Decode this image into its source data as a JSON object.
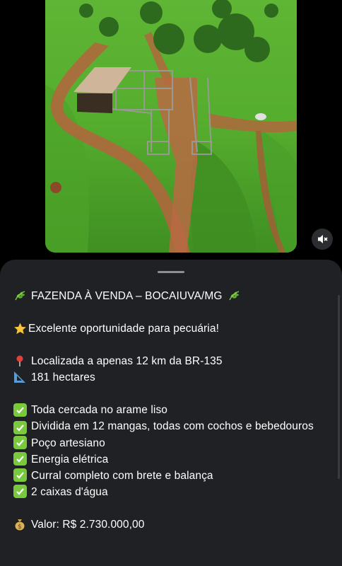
{
  "media": {
    "image_description_icon": "aerial-farm-photo",
    "mute_icon": "speaker-muted-icon"
  },
  "post": {
    "title_emoji": "herb-icon",
    "title": "FAZENDA À VENDA – BOCAIUVA/MG",
    "subtitle_emoji": "star-icon",
    "subtitle": "Excelente oportunidade para pecuária!",
    "location_emoji": "pin-icon",
    "location": "Localizada a apenas 12 km da BR-135",
    "area_emoji": "ruler-icon",
    "area": "181 hectares",
    "features": [
      "Toda cercada no arame liso",
      "Dividida em 12 mangas, todas com cochos e bebedouros",
      "Poço artesiano",
      "Energia elétrica",
      "Curral completo com brete e balança",
      "2 caixas d'água"
    ],
    "price_emoji": "money-bag-icon",
    "price": "Valor: R$ 2.730.000,00"
  },
  "colors": {
    "sheet_bg": "#202125",
    "check_green": "#78c93c",
    "grass": "#59b332",
    "dirt": "#b4643d"
  }
}
